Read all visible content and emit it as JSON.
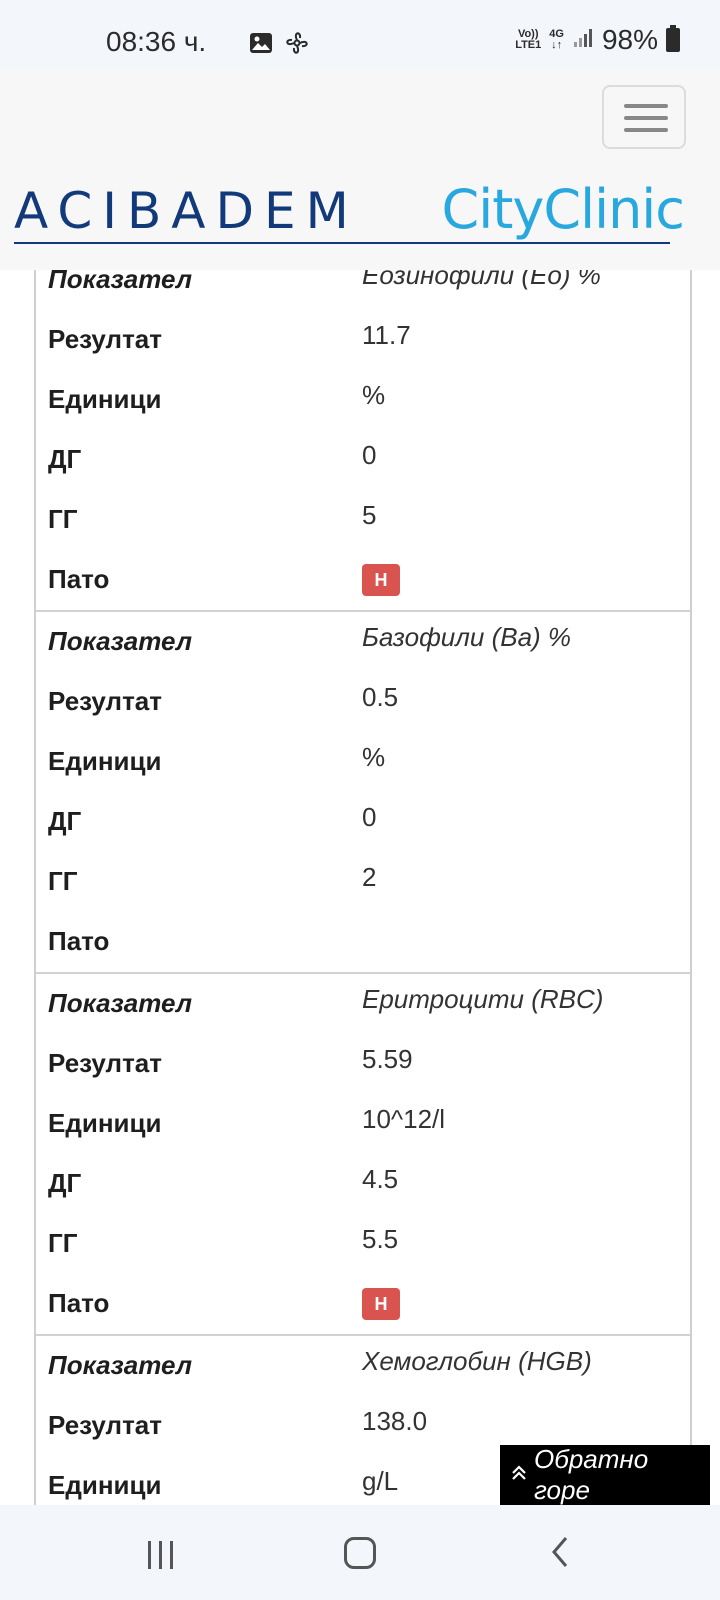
{
  "status_bar": {
    "time": "08:36 ч.",
    "volte_top": "Vo))",
    "volte_bottom": "LTE1",
    "network": "4G",
    "battery": "98%",
    "icons": [
      "gallery-icon",
      "fan-icon",
      "signal-icon",
      "battery-icon"
    ]
  },
  "header": {
    "logo_left": "ACIBADEM",
    "logo_right": "CityClinic",
    "brand_colors": {
      "primary": "#123a7a",
      "secondary": "#28a8de"
    }
  },
  "results": [
    {
      "indicator_label": "Показател",
      "indicator_value": "Еозинофили (Eo) %",
      "result_label": "Резултат",
      "result_value": "11.7",
      "units_label": "Единици",
      "units_value": "%",
      "low_label": "ДГ",
      "low_value": "0",
      "high_label": "ГГ",
      "high_value": "5",
      "patho_label": "Пато",
      "patho_value": "H"
    },
    {
      "indicator_label": "Показател",
      "indicator_value": "Базофили (Ba) %",
      "result_label": "Резултат",
      "result_value": "0.5",
      "units_label": "Единици",
      "units_value": "%",
      "low_label": "ДГ",
      "low_value": "0",
      "high_label": "ГГ",
      "high_value": "2",
      "patho_label": "Пато",
      "patho_value": ""
    },
    {
      "indicator_label": "Показател",
      "indicator_value": "Еритроцити (RBC)",
      "result_label": "Резултат",
      "result_value": "5.59",
      "units_label": "Единици",
      "units_value": "10^12/l",
      "low_label": "ДГ",
      "low_value": "4.5",
      "high_label": "ГГ",
      "high_value": "5.5",
      "patho_label": "Пато",
      "patho_value": "H"
    },
    {
      "indicator_label": "Показател",
      "indicator_value": "Хемоглобин (HGB)",
      "result_label": "Резултат",
      "result_value": "138.0",
      "units_label": "Единици",
      "units_value": "g/L"
    }
  ],
  "back_to_top": {
    "label": "Обратно горе",
    "icon": "double-chevron-up-icon"
  },
  "badge_color": "#d9534f"
}
